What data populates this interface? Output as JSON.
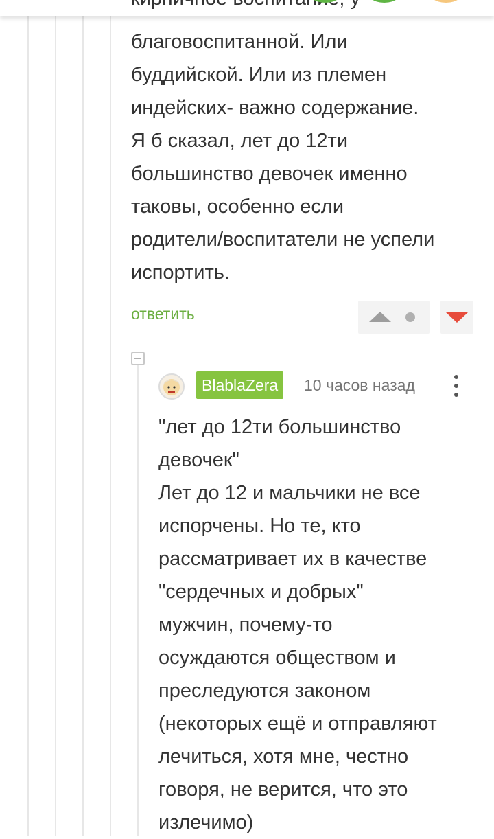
{
  "header": {
    "clipped_text": "кирпичное воспитание, у"
  },
  "parent_comment": {
    "text": "благовоспитанной. Или\nбуддийской. Или из племен\nиндейских- важно содержание.\nЯ б сказал, лет до 12ти\nбольшинство девочек именно\nтаковы, особенно если\nродители/воспитатели не успели\nиспортить.",
    "reply_label": "ответить",
    "rating": ""
  },
  "reply_comment": {
    "username": "BlablaZera",
    "time": "10 часов назад",
    "text": "\"лет до 12ти большинство\nдевочек\"\nЛет до 12 и мальчики не все\nиспорчены. Но те, кто\nрассматривает их в качестве\n\"сердечных и добрых\"\nмужчин, почему-то\nосуждаются обществом и\nпреследуются законом\n(некоторых ещё и отправляют\nлечиться, хотя мне, честно\nговоря, не верится, что это\nизлечимо)"
  },
  "colors": {
    "reply_link": "#6bae40",
    "username_badge": "#86c440",
    "downvote": "#e74c3c",
    "upvote": "#9d9d9d"
  },
  "icons": {
    "upvote": "triangle-up-icon",
    "downvote": "triangle-down-icon",
    "rating_dot": "dot-icon",
    "collapse": "minus-square-icon",
    "menu": "vertical-ellipsis-icon"
  }
}
